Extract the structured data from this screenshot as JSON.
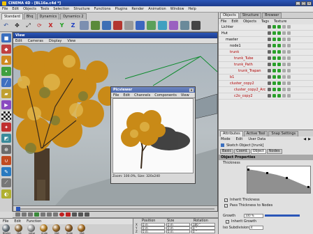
{
  "app": {
    "title": "CINEMA 4D - [BL16a.c4d *]"
  },
  "menu": [
    "File",
    "Edit",
    "Objects",
    "Tools",
    "Selection",
    "Structure",
    "Functions",
    "Plugins",
    "Render",
    "Animation",
    "Window",
    "Help"
  ],
  "layout_tabs": [
    "Standard",
    "Bhq",
    "Dynamics",
    "Dynamics 2"
  ],
  "viewport": {
    "title": "View",
    "menu": [
      "Edit",
      "Cameras",
      "Display",
      "View"
    ]
  },
  "picture_viewer": {
    "title": "Picviewer",
    "menu": [
      "File",
      "Edit",
      "Channels",
      "Components",
      "View"
    ],
    "status": "Zoom: 100.0%, Size: 320x240"
  },
  "object_manager": {
    "tabs": [
      "Objects",
      "Structure",
      "Browser"
    ],
    "menu": [
      "File",
      "Edit",
      "Objects",
      "Tags",
      "Texture"
    ],
    "items": [
      {
        "label": "Lichter",
        "indent": 0,
        "color": "#000000"
      },
      {
        "label": "Hut",
        "indent": 0,
        "color": "#000000"
      },
      {
        "label": "master",
        "indent": 1,
        "color": "#000000"
      },
      {
        "label": "node1",
        "indent": 2,
        "color": "#000000"
      },
      {
        "label": "trunk",
        "indent": 2,
        "color": "#b00000"
      },
      {
        "label": "trunk_Tube",
        "indent": 3,
        "color": "#b00000"
      },
      {
        "label": "trunk_Path",
        "indent": 3,
        "color": "#b00000"
      },
      {
        "label": "trunk_Trapan",
        "indent": 4,
        "color": "#b00000"
      },
      {
        "label": "b1",
        "indent": 2,
        "color": "#b00000"
      },
      {
        "label": "cluster_copy2",
        "indent": 2,
        "color": "#b00000"
      },
      {
        "label": "cluster_copy2_Arc",
        "indent": 3,
        "color": "#b00000"
      },
      {
        "label": "c2o_copy2",
        "indent": 3,
        "color": "#b00000"
      }
    ]
  },
  "attributes": {
    "tabs": [
      "Attributes",
      "Active Tool",
      "Snap Settings"
    ],
    "menu": [
      "Mode",
      "Edit",
      "User Data"
    ],
    "object_label": "Sketch Object [trunk]",
    "subtabs": [
      "Basic",
      "Coord.",
      "Object",
      "Nodes"
    ],
    "section": "Object Properties",
    "thickness_label": "Thickness",
    "checks": [
      {
        "label": "Inherit Thickness",
        "checked": true
      },
      {
        "label": "Pass Thickness to Nodes",
        "checked": true
      }
    ],
    "growth_label": "Growth",
    "growth_value": "100 %",
    "inherit_growth_label": "Inherit Growth",
    "subdivision_label": "Iso Subdivision",
    "subdivision_value": "4"
  },
  "material_manager": {
    "menu": [
      "File",
      "Edit",
      "Function"
    ],
    "materials": [
      {
        "name": "Blister",
        "color": "#6f7a83"
      },
      {
        "name": "Mat",
        "color": "#8d6a3a"
      },
      {
        "name": "ndise",
        "color": "#9a9a9a"
      },
      {
        "name": "rinde",
        "color": "#b57d20"
      },
      {
        "name": "Mat",
        "color": "#9c6d2b"
      },
      {
        "name": "rinde",
        "color": "#8a5a23"
      },
      {
        "name": "Mat",
        "color": "#a46a1e"
      }
    ]
  },
  "coordinates": {
    "headers": [
      "Position",
      "Size",
      "Rotation"
    ],
    "rows": [
      {
        "axis": "X",
        "pos": "0 m",
        "size": "0 m",
        "rot": "180 °"
      },
      {
        "axis": "Y",
        "pos": "0 m",
        "size": "0 m",
        "rot": "0 °"
      },
      {
        "axis": "Z",
        "pos": "0 m",
        "size": "0 m",
        "rot": "0 °"
      }
    ],
    "mode": "Object",
    "size_mode": "Scale",
    "apply": "Apply"
  }
}
